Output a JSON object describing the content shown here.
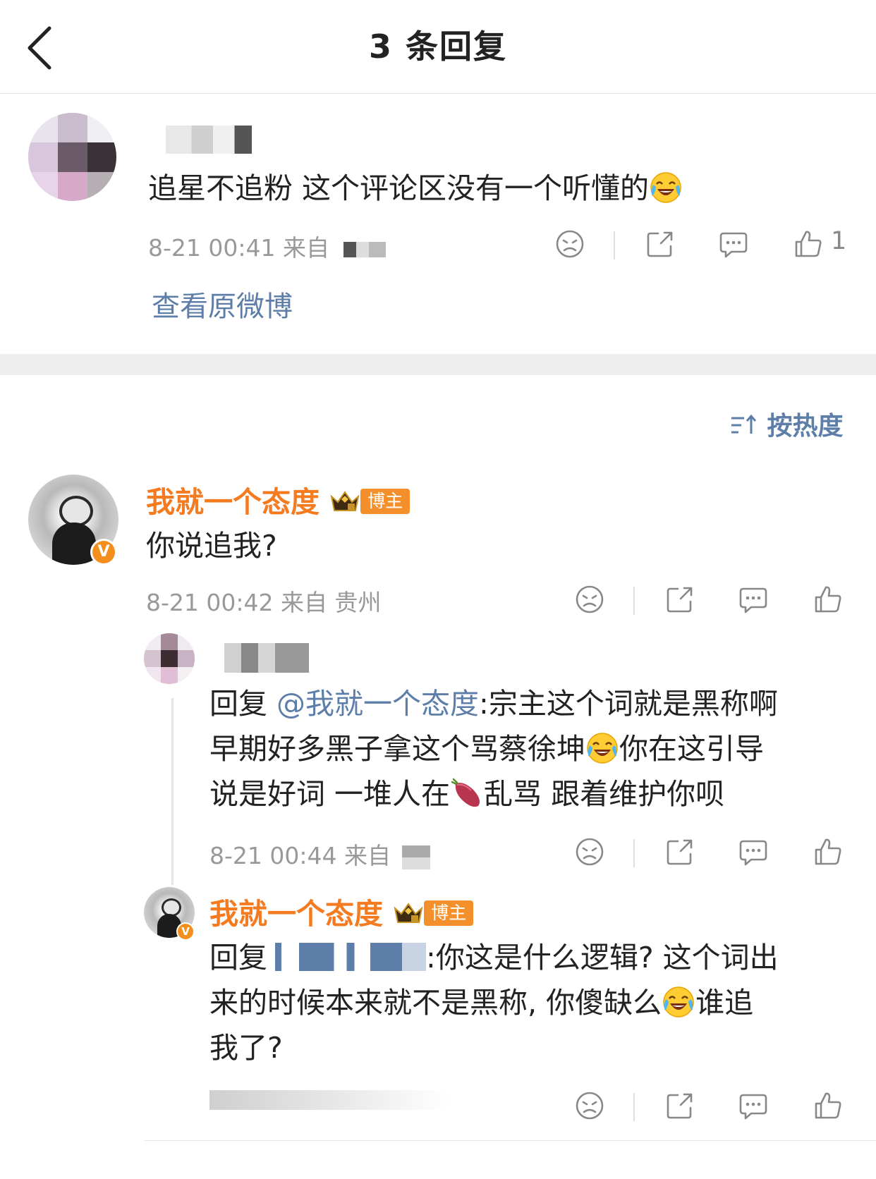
{
  "header": {
    "title": "3 条回复"
  },
  "root_comment": {
    "text": "追星不追粉 这个评论区没有一个听懂的",
    "time": "8-21 00:41 来自",
    "like_count": "1",
    "view_original": "查看原微博"
  },
  "sort": {
    "label": "按热度"
  },
  "reply1": {
    "username": "我就一个态度",
    "badge": "博主",
    "text": "你说追我?",
    "meta": "8-21 00:42 来自 贵州"
  },
  "reply2": {
    "prefix": "回复",
    "mention": "@我就一个态度",
    "line1_rest": ":宗主这个词就是黑称啊",
    "line2a": "早期好多黑子拿这个骂蔡徐坤",
    "line2b": "你在这引导",
    "line3a": "说是好词 一堆人在",
    "line3b": "乱骂 跟着维护你呗",
    "meta": "8-21 00:44 来自"
  },
  "reply3": {
    "username": "我就一个态度",
    "badge": "博主",
    "prefix": "回复",
    "line1_rest": ":你这是什么逻辑? 这个词出",
    "line2a": "来的时候本来就不是黑称, 你傻缺么",
    "line2b": "谁追",
    "line3": "我了?"
  },
  "colors": {
    "accent_orange": "#f47b20",
    "link_blue": "#5d7ea8",
    "meta_gray": "#999999"
  },
  "icons": [
    "back-icon",
    "dislike-icon",
    "share-icon",
    "comment-icon",
    "like-icon",
    "sort-icon",
    "crown-icon",
    "verified-icon",
    "laugh-cry-emoji",
    "sweet-potato-emoji"
  ]
}
